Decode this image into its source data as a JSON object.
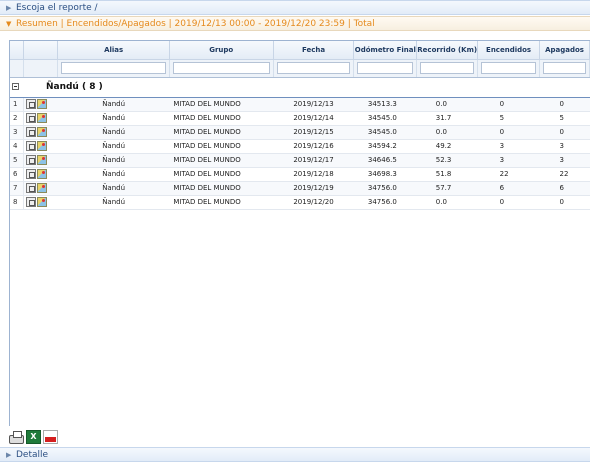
{
  "report_header": {
    "label": "Escoja el reporte /"
  },
  "summary_header": {
    "label": "Resumen | Encendidos/Apagados | 2019/12/13 00:00 - 2019/12/20 23:59 | Total"
  },
  "detail_header": {
    "label": "Detalle"
  },
  "table": {
    "columns": [
      "Alias",
      "Grupo",
      "Fecha",
      "Odómetro Final",
      "Recorrido (Km)",
      "Encendidos",
      "Apagados"
    ],
    "group_title": "Ñandú ( 8 )",
    "rows": [
      {
        "n": "1",
        "alias": "Ñandú",
        "grupo": "MITAD DEL MUNDO",
        "fecha": "2019/12/13",
        "odometro": "34513.3",
        "recorrido": "0.0",
        "encendidos": "0",
        "apagados": "0"
      },
      {
        "n": "2",
        "alias": "Ñandú",
        "grupo": "MITAD DEL MUNDO",
        "fecha": "2019/12/14",
        "odometro": "34545.0",
        "recorrido": "31.7",
        "encendidos": "5",
        "apagados": "5"
      },
      {
        "n": "3",
        "alias": "Ñandú",
        "grupo": "MITAD DEL MUNDO",
        "fecha": "2019/12/15",
        "odometro": "34545.0",
        "recorrido": "0.0",
        "encendidos": "0",
        "apagados": "0"
      },
      {
        "n": "4",
        "alias": "Ñandú",
        "grupo": "MITAD DEL MUNDO",
        "fecha": "2019/12/16",
        "odometro": "34594.2",
        "recorrido": "49.2",
        "encendidos": "3",
        "apagados": "3"
      },
      {
        "n": "5",
        "alias": "Ñandú",
        "grupo": "MITAD DEL MUNDO",
        "fecha": "2019/12/17",
        "odometro": "34646.5",
        "recorrido": "52.3",
        "encendidos": "3",
        "apagados": "3"
      },
      {
        "n": "6",
        "alias": "Ñandú",
        "grupo": "MITAD DEL MUNDO",
        "fecha": "2019/12/18",
        "odometro": "34698.3",
        "recorrido": "51.8",
        "encendidos": "22",
        "apagados": "22"
      },
      {
        "n": "7",
        "alias": "Ñandú",
        "grupo": "MITAD DEL MUNDO",
        "fecha": "2019/12/19",
        "odometro": "34756.0",
        "recorrido": "57.7",
        "encendidos": "6",
        "apagados": "6"
      },
      {
        "n": "8",
        "alias": "Ñandú",
        "grupo": "MITAD DEL MUNDO",
        "fecha": "2019/12/20",
        "odometro": "34756.0",
        "recorrido": "0.0",
        "encendidos": "0",
        "apagados": "0"
      }
    ]
  },
  "toolbar": {
    "icons": [
      "printer-icon",
      "excel-icon",
      "pdf-icon"
    ]
  },
  "colors": {
    "accent_orange": "#e58a1d",
    "header_blue": "#2b4f82",
    "border_blue": "#9db3d1"
  }
}
